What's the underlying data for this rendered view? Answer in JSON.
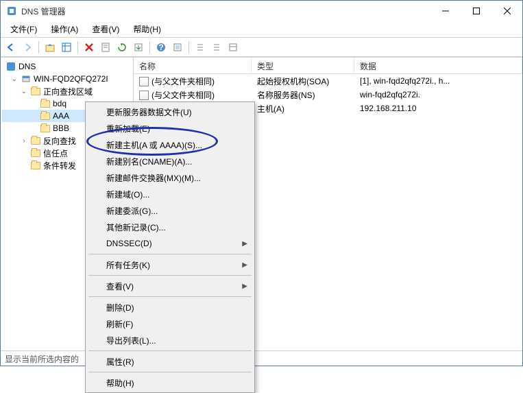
{
  "window": {
    "title": "DNS 管理器"
  },
  "menu": {
    "file": "文件(F)",
    "action": "操作(A)",
    "view": "查看(V)",
    "help": "帮助(H)"
  },
  "tree": {
    "root": "DNS",
    "server": "WIN-FQD2QFQ272I",
    "fwd": "正向查找区域",
    "zones": [
      "bdq",
      "AAA",
      "BBB"
    ],
    "rev": "反向查找",
    "trust": "信任点",
    "cond": "条件转发"
  },
  "columns": {
    "name": "名称",
    "type": "类型",
    "data": "数据"
  },
  "records": [
    {
      "name": "(与父文件夹相同)",
      "type": "起始授权机构(SOA)",
      "data": "[1], win-fqd2qfq272i., h..."
    },
    {
      "name": "(与父文件夹相同)",
      "type": "名称服务器(NS)",
      "data": "win-fqd2qfq272i."
    },
    {
      "name": "",
      "type": "主机(A)",
      "data": "192.168.211.10"
    }
  ],
  "context": {
    "update": "更新服务器数据文件(U)",
    "reload": "重新加载(E)",
    "newhost": "新建主机(A 或 AAAA)(S)...",
    "newcname": "新建别名(CNAME)(A)...",
    "newmx": "新建邮件交换器(MX)(M)...",
    "newdomain": "新建域(O)...",
    "newdeleg": "新建委派(G)...",
    "other": "其他新记录(C)...",
    "dnssec": "DNSSEC(D)",
    "alltasks": "所有任务(K)",
    "view": "查看(V)",
    "delete": "删除(D)",
    "refresh": "刷新(F)",
    "export": "导出列表(L)...",
    "props": "属性(R)",
    "help": "帮助(H)"
  },
  "status": "显示当前所选内容的"
}
